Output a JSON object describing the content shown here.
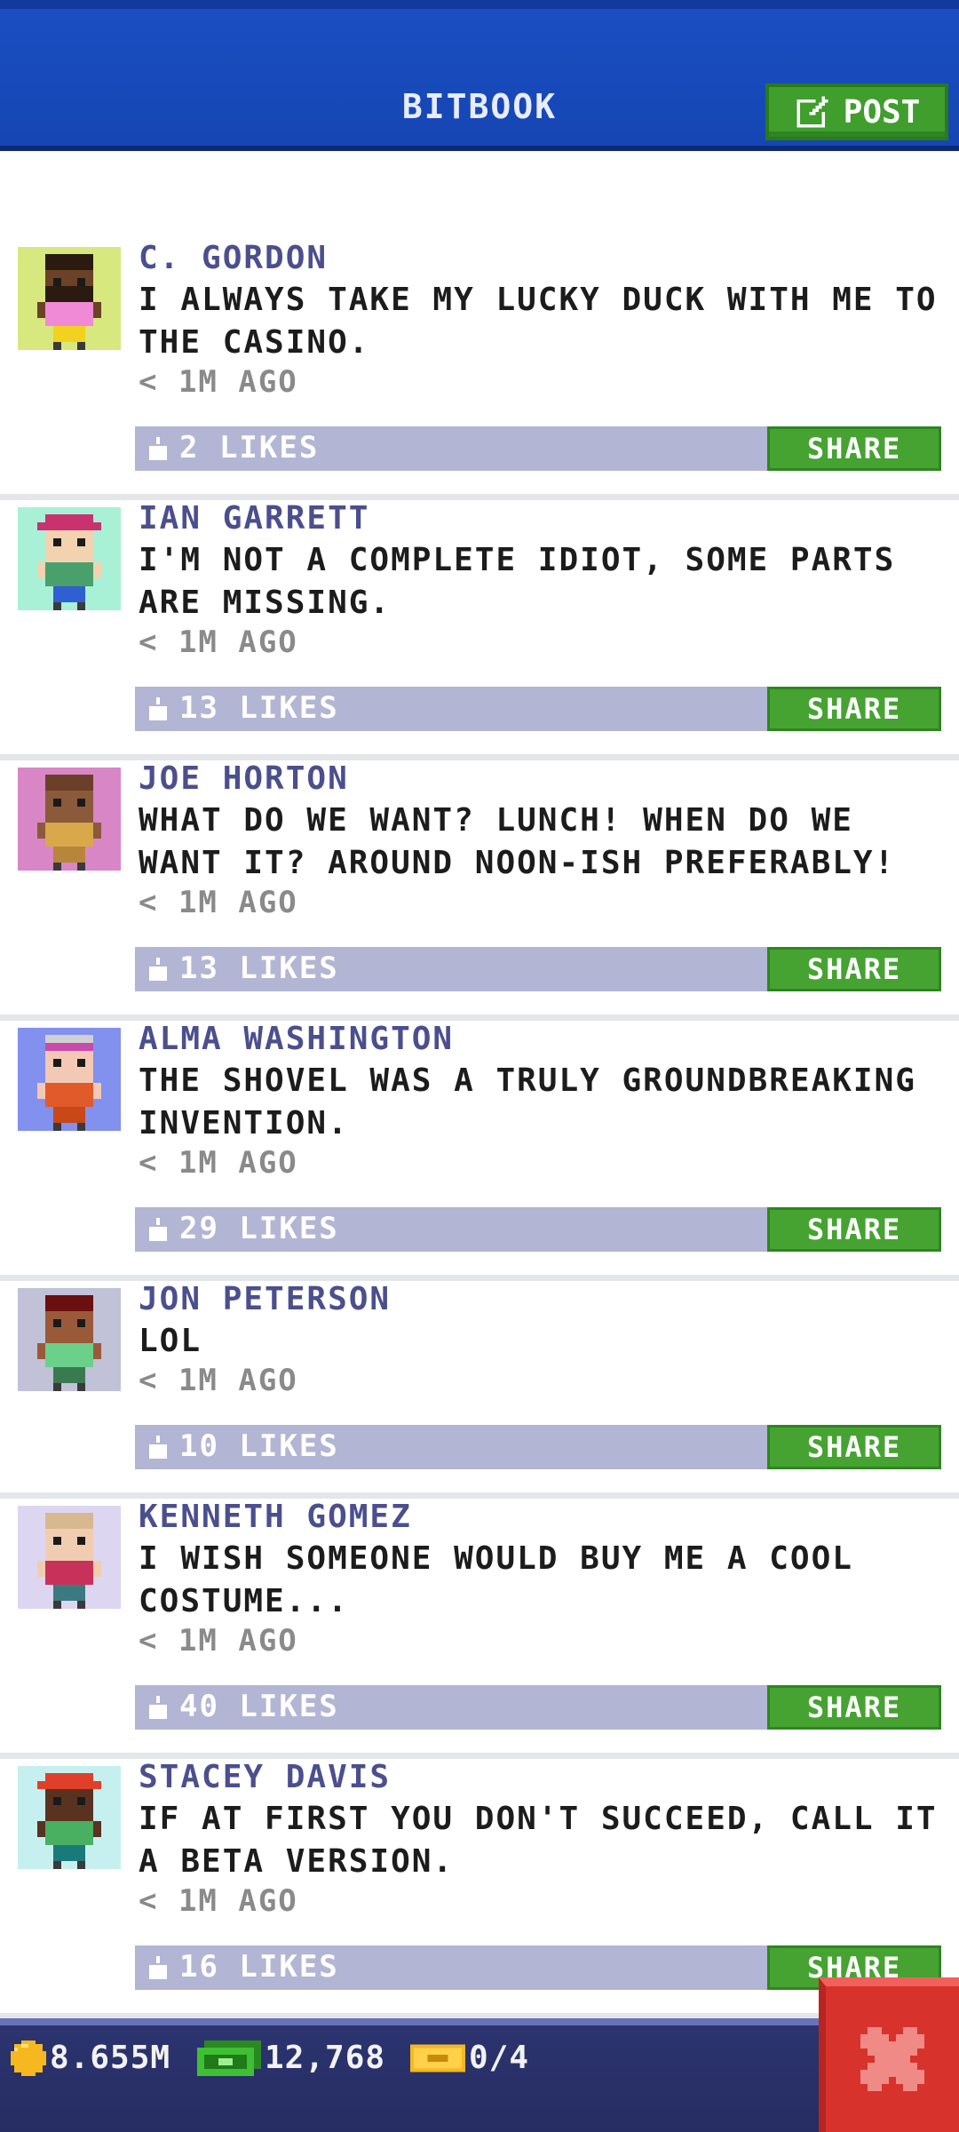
{
  "header": {
    "title": "BITBOOK",
    "post_label": "POST",
    "post_icon": "edit-icon"
  },
  "colors": {
    "header_blue": "#1546b3",
    "green_button": "#46a332",
    "likebar": "#b3b5d4",
    "name_text": "#4b4f8e",
    "close_red": "#d8322c"
  },
  "posts": [
    {
      "name": "C. GORDON",
      "message": "I ALWAYS TAKE MY LUCKY DUCK WITH ME TO THE CASINO.",
      "time": "< 1M AGO",
      "likes": "2 LIKES",
      "share": "SHARE",
      "avatar_bg": "#d7e87e"
    },
    {
      "name": "IAN GARRETT",
      "message": "I'M NOT A COMPLETE IDIOT, SOME PARTS ARE MISSING.",
      "time": "< 1M AGO",
      "likes": "13 LIKES",
      "share": "SHARE",
      "avatar_bg": "#a8f0d6"
    },
    {
      "name": "JOE HORTON",
      "message": "WHAT DO WE WANT? LUNCH! WHEN DO WE WANT IT? AROUND NOON-ISH PREFERABLY!",
      "time": "< 1M AGO",
      "likes": "13 LIKES",
      "share": "SHARE",
      "avatar_bg": "#d886c6"
    },
    {
      "name": "ALMA WASHINGTON",
      "message": "THE SHOVEL WAS A TRULY GROUNDBREAKING INVENTION.",
      "time": "< 1M AGO",
      "likes": "29 LIKES",
      "share": "SHARE",
      "avatar_bg": "#8290ee"
    },
    {
      "name": "JON PETERSON",
      "message": "LOL",
      "time": "< 1M AGO",
      "likes": "10 LIKES",
      "share": "SHARE",
      "avatar_bg": "#c1c1d8"
    },
    {
      "name": "KENNETH GOMEZ",
      "message": "I WISH SOMEONE WOULD BUY ME A COOL COSTUME...",
      "time": "< 1M AGO",
      "likes": "40 LIKES",
      "share": "SHARE",
      "avatar_bg": "#ddd6f0"
    },
    {
      "name": "STACEY DAVIS",
      "message": "IF AT FIRST YOU DON'T SUCCEED, CALL IT A BETA VERSION.",
      "time": "< 1M AGO",
      "likes": "16 LIKES",
      "share": "SHARE",
      "avatar_bg": "#c6f0f0"
    }
  ],
  "footer": {
    "coins": "8.655M",
    "bux": "12,768",
    "tickets": "0/4",
    "coin_icon": "coin-icon",
    "bux_icon": "bux-icon",
    "ticket_icon": "ticket-icon",
    "close_icon": "close-icon"
  }
}
